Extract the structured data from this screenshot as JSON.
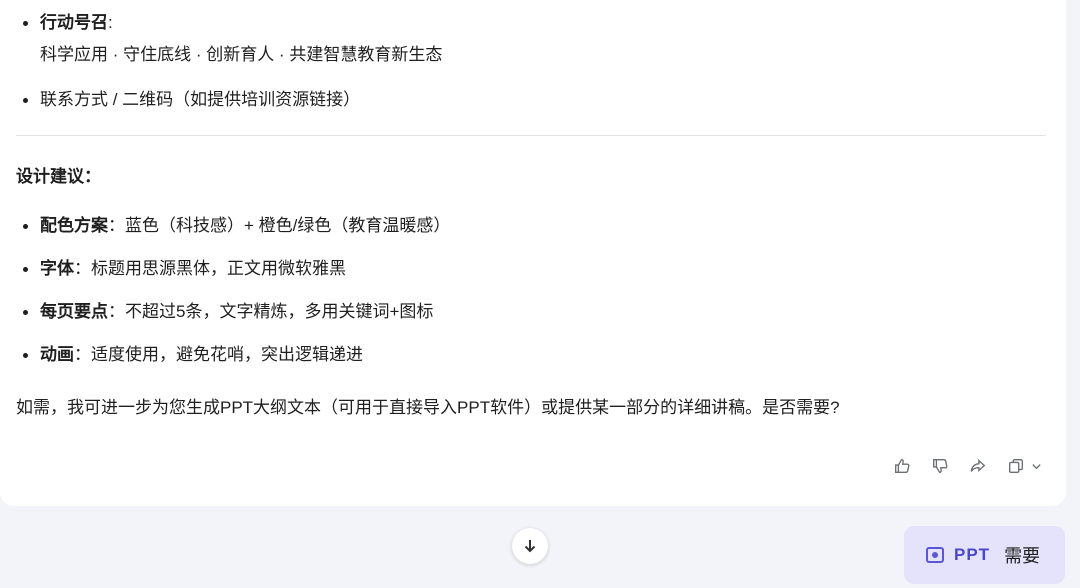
{
  "call_to_action": {
    "label": "行动号召",
    "colon": ":",
    "text": "科学应用 · 守住底线 · 创新育人 · 共建智慧教育新生态"
  },
  "contact": {
    "text": "联系方式 / 二维码（如提供培训资源链接）"
  },
  "design": {
    "heading": "设计建议：",
    "items": [
      {
        "label": "配色方案",
        "text": "：蓝色（科技感）+ 橙色/绿色（教育温暖感）"
      },
      {
        "label": "字体",
        "text": "：标题用思源黑体，正文用微软雅黑"
      },
      {
        "label": "每页要点",
        "text": "：不超过5条，文字精炼，多用关键词+图标"
      },
      {
        "label": "动画",
        "text": "：适度使用，避免花哨，突出逻辑递进"
      }
    ]
  },
  "closing": "如需，我可进一步为您生成PPT大纲文本（可用于直接导入PPT软件）或提供某一部分的详细讲稿。是否需要?",
  "actions": {
    "icons": [
      "thumbs-up-icon",
      "thumbs-down-icon",
      "share-icon",
      "copy-icon",
      "chevron-down-icon"
    ]
  },
  "chip": {
    "label": "PPT",
    "extra": "需要"
  }
}
